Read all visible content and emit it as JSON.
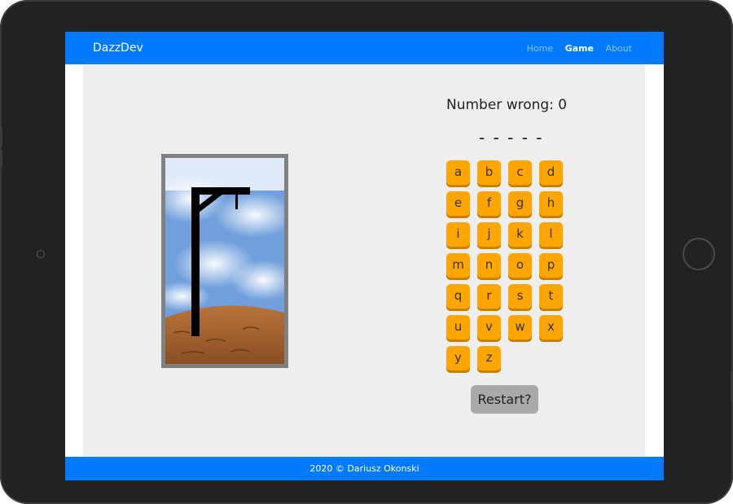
{
  "navbar": {
    "brand": "DazzDev",
    "links": [
      {
        "label": "Home",
        "active": false
      },
      {
        "label": "Game",
        "active": true
      },
      {
        "label": "About",
        "active": false
      }
    ]
  },
  "game": {
    "wrong_label": "Number wrong: 0",
    "word_mask": "- - - - -",
    "letters": [
      "a",
      "b",
      "c",
      "d",
      "e",
      "f",
      "g",
      "h",
      "i",
      "j",
      "k",
      "l",
      "m",
      "n",
      "o",
      "p",
      "q",
      "r",
      "s",
      "t",
      "u",
      "v",
      "w",
      "x",
      "y",
      "z"
    ],
    "restart_label": "Restart?"
  },
  "footer": {
    "text": "2020 © Dariusz Okonski"
  },
  "colors": {
    "primary": "#007bff",
    "letter_button": "#ffa500",
    "restart_button": "#a9a9a9"
  }
}
